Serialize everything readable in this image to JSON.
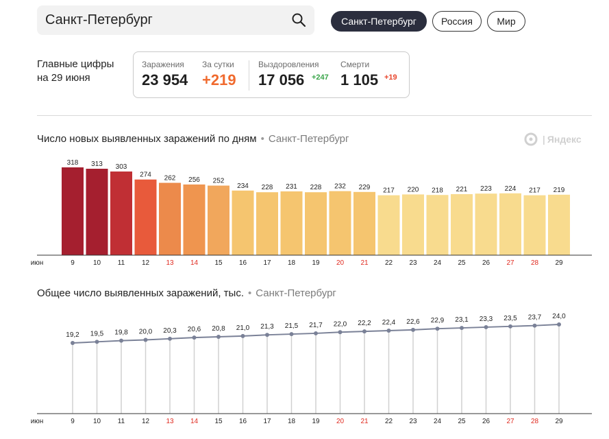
{
  "search": {
    "value": "Санкт-Петербург"
  },
  "regions": [
    {
      "label": "Санкт-Петербург",
      "active": true
    },
    {
      "label": "Россия",
      "active": false
    },
    {
      "label": "Мир",
      "active": false
    }
  ],
  "stats": {
    "label_line1": "Главные цифры",
    "label_line2": "на 29 июня",
    "infections_caption": "Заражения",
    "infections_value": "23 954",
    "daily_caption": "За сутки",
    "daily_value": "+219",
    "recovered_caption": "Выздоровления",
    "recovered_value": "17 056",
    "recovered_delta": "+247",
    "deaths_caption": "Смерти",
    "deaths_value": "1 105",
    "deaths_delta": "+19"
  },
  "watermark": "Яндекс",
  "colors": {
    "accent_orange": "#f06a2e",
    "delta_green": "#3aa54a",
    "weekend_red": "#e02a1f",
    "line": "#7a8197"
  },
  "chart_data": [
    {
      "type": "bar",
      "title": "Число новых выявленных заражений по дням",
      "region": "Санкт-Петербург",
      "month_label": "июн",
      "categories": [
        "9",
        "10",
        "11",
        "12",
        "13",
        "14",
        "15",
        "16",
        "17",
        "18",
        "19",
        "20",
        "21",
        "22",
        "23",
        "24",
        "25",
        "26",
        "27",
        "28",
        "29"
      ],
      "weekend_days": [
        "13",
        "14",
        "20",
        "21",
        "27",
        "28"
      ],
      "values": [
        318,
        313,
        303,
        274,
        262,
        256,
        252,
        234,
        228,
        231,
        228,
        232,
        229,
        217,
        220,
        218,
        221,
        223,
        224,
        217,
        219
      ],
      "bar_colors": [
        "#a51f2f",
        "#a51f2f",
        "#c02f34",
        "#e85a3b",
        "#ec8a4b",
        "#ef954f",
        "#f1a75c",
        "#f5c56f",
        "#f5c56f",
        "#f5c56f",
        "#f5c56f",
        "#f5c56f",
        "#f5c56f",
        "#f8db8e",
        "#f8db8e",
        "#f8db8e",
        "#f8db8e",
        "#f8db8e",
        "#f8db8e",
        "#f8db8e",
        "#f8db8e"
      ]
    },
    {
      "type": "line",
      "title": "Общее число выявленных заражений, тыс.",
      "region": "Санкт-Петербург",
      "month_label": "июн",
      "categories": [
        "9",
        "10",
        "11",
        "12",
        "13",
        "14",
        "15",
        "16",
        "17",
        "18",
        "19",
        "20",
        "21",
        "22",
        "23",
        "24",
        "25",
        "26",
        "27",
        "28",
        "29"
      ],
      "weekend_days": [
        "13",
        "14",
        "20",
        "21",
        "27",
        "28"
      ],
      "values": [
        19.2,
        19.5,
        19.8,
        20.0,
        20.3,
        20.6,
        20.8,
        21.0,
        21.3,
        21.5,
        21.7,
        22.0,
        22.2,
        22.4,
        22.6,
        22.9,
        23.1,
        23.3,
        23.5,
        23.7,
        24.0
      ],
      "labels": [
        "19,2",
        "19,5",
        "19,8",
        "20,0",
        "20,3",
        "20,6",
        "20,8",
        "21,0",
        "21,3",
        "21,5",
        "21,7",
        "22,0",
        "22,2",
        "22,4",
        "22,6",
        "22,9",
        "23,1",
        "23,3",
        "23,5",
        "23,7",
        "24,0"
      ]
    }
  ]
}
